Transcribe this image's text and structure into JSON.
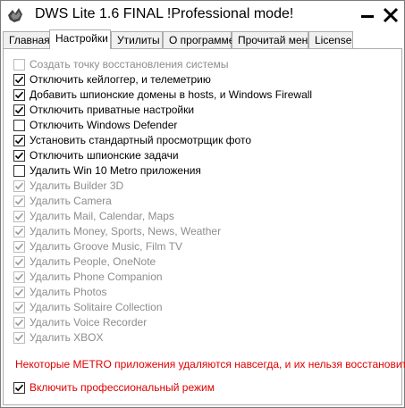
{
  "window": {
    "title": "DWS Lite 1.6 FINAL  !Professional mode!",
    "minimize_icon": "minimize-icon",
    "close_icon": "close-icon"
  },
  "tabs": [
    {
      "label": "Главная",
      "active": false
    },
    {
      "label": "Настройки",
      "active": true
    },
    {
      "label": "Утилиты",
      "active": false
    },
    {
      "label": "О программе",
      "active": false
    },
    {
      "label": "Прочитай меня",
      "active": false
    },
    {
      "label": "License",
      "active": false
    }
  ],
  "options": [
    {
      "label": "Создать точку восстановления системы",
      "checked": false,
      "enabled": false
    },
    {
      "label": "Отключить кейлоггер, и телеметрию",
      "checked": true,
      "enabled": true
    },
    {
      "label": "Добавить шпионские домены в hosts, и Windows Firewall",
      "checked": true,
      "enabled": true
    },
    {
      "label": "Отключить приватные настройки",
      "checked": true,
      "enabled": true
    },
    {
      "label": "Отключить Windows Defender",
      "checked": false,
      "enabled": true
    },
    {
      "label": "Установить стандартный просмотрщик фото",
      "checked": true,
      "enabled": true
    },
    {
      "label": "Отключить шпионские задачи",
      "checked": true,
      "enabled": true
    },
    {
      "label": "Удалить Win 10 Metro приложения",
      "checked": false,
      "enabled": true
    },
    {
      "label": "Удалить Builder 3D",
      "checked": true,
      "enabled": false
    },
    {
      "label": "Удалить Camera",
      "checked": true,
      "enabled": false
    },
    {
      "label": "Удалить Mail, Calendar, Maps",
      "checked": true,
      "enabled": false
    },
    {
      "label": "Удалить Money, Sports, News, Weather",
      "checked": true,
      "enabled": false
    },
    {
      "label": "Удалить Groove Music, Film TV",
      "checked": true,
      "enabled": false
    },
    {
      "label": "Удалить People, OneNote",
      "checked": true,
      "enabled": false
    },
    {
      "label": "Удалить Phone Companion",
      "checked": true,
      "enabled": false
    },
    {
      "label": "Удалить Photos",
      "checked": true,
      "enabled": false
    },
    {
      "label": "Удалить Solitaire Collection",
      "checked": true,
      "enabled": false
    },
    {
      "label": "Удалить Voice Recorder",
      "checked": true,
      "enabled": false
    },
    {
      "label": "Удалить XBOX",
      "checked": true,
      "enabled": false
    }
  ],
  "warning": "Некоторые METRO приложения удаляются навсегда, и их нельзя восстановить",
  "pro_mode": {
    "label": "Включить профессиональный режим",
    "checked": true
  },
  "colors": {
    "warning": "#e00000",
    "disabled_text": "#8d8d8d"
  }
}
